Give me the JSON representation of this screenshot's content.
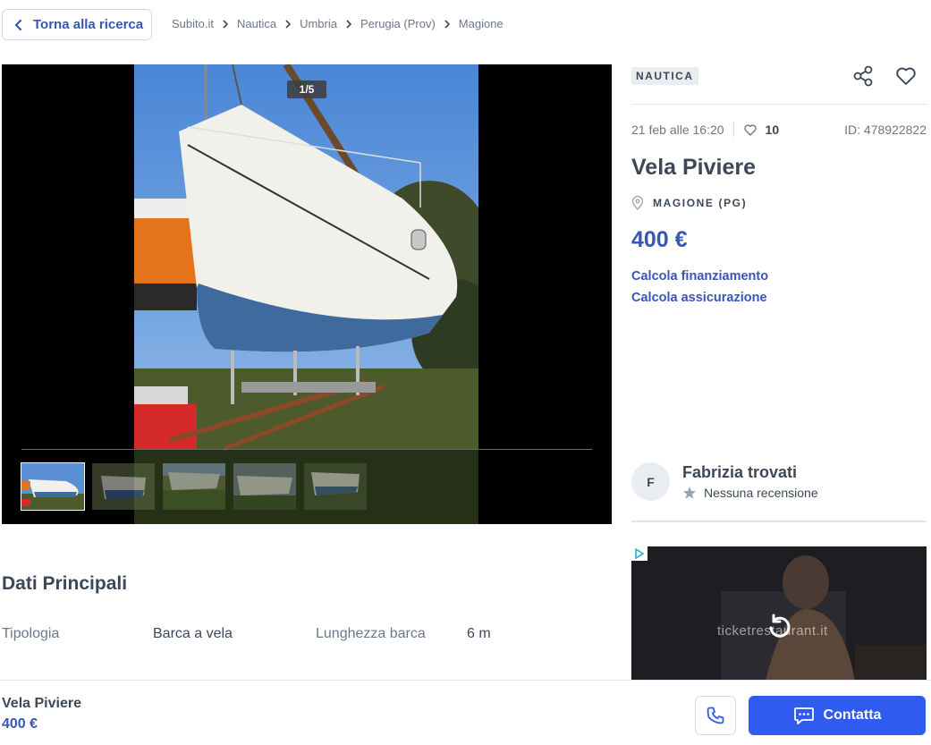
{
  "nav": {
    "back_label": "Torna alla ricerca",
    "breadcrumb": [
      "Subito.it",
      "Nautica",
      "Umbria",
      "Perugia (Prov)",
      "Magione"
    ]
  },
  "gallery": {
    "counter": "1/5",
    "current_index": 1,
    "total": 5,
    "thumbnail_count": 5
  },
  "listing": {
    "category_badge": "NAUTICA",
    "date": "21 feb alle 16:20",
    "likes": "10",
    "id": "ID: 478922822",
    "title": "Vela Piviere",
    "location": "MAGIONE (PG)",
    "price": "400 €",
    "link_financing": "Calcola finanziamento",
    "link_insurance": "Calcola assicurazione"
  },
  "seller": {
    "initial": "F",
    "name": "Fabrizia trovati",
    "review": "Nessuna recensione"
  },
  "ad": {
    "text": "ticketrestaurant.it"
  },
  "details": {
    "title": "Dati Principali",
    "rows": [
      {
        "label": "Tipologia",
        "value": "Barca a vela"
      },
      {
        "label": "Lunghezza barca",
        "value": "6 m"
      }
    ]
  },
  "footer": {
    "title": "Vela Piviere",
    "price": "400 €",
    "contact_label": "Contatta"
  },
  "colors": {
    "accent": "#3756b8",
    "primary_button": "#2f5bf0",
    "text": "#3c4858",
    "muted": "#6c7787"
  }
}
